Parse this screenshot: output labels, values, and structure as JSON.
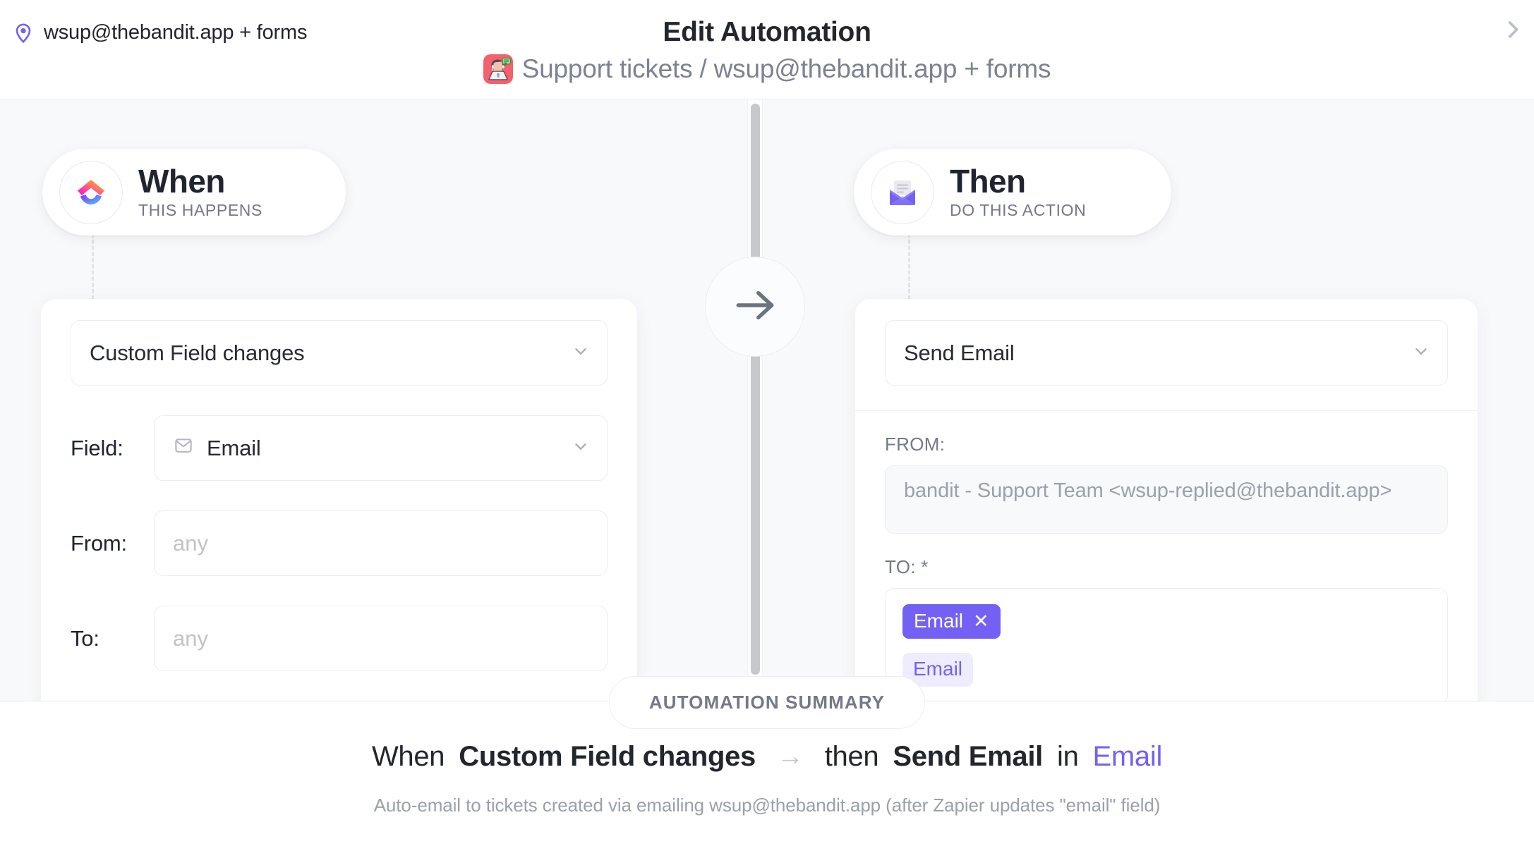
{
  "header": {
    "breadcrumb_label": "wsup@thebandit.app + forms",
    "pin_icon": "location-pin-icon",
    "title": "Edit Automation",
    "subtitle": "Support tickets / wsup@thebandit.app + forms",
    "subtitle_emoji": "support-agent-emoji",
    "close_icon": "chevron-right-icon"
  },
  "when": {
    "icon": "clickup-logo-icon",
    "title": "When",
    "subtitle": "THIS HAPPENS",
    "trigger": {
      "value": "Custom Field changes",
      "chevron": "chevron-down-icon"
    },
    "fields": [
      {
        "label": "Field:",
        "type": "select",
        "icon": "envelope-outline-icon",
        "value": "Email",
        "chevron": "chevron-down-icon"
      },
      {
        "label": "From:",
        "type": "input",
        "value": "",
        "placeholder": "any"
      },
      {
        "label": "To:",
        "type": "input",
        "value": "",
        "placeholder": "any"
      }
    ]
  },
  "connector": {
    "arrow_icon": "arrow-right-icon"
  },
  "then": {
    "icon": "open-envelope-icon",
    "title": "Then",
    "subtitle": "DO THIS ACTION",
    "action": {
      "value": "Send Email",
      "chevron": "chevron-down-icon"
    },
    "from": {
      "label": "FROM:",
      "value": "bandit - Support Team <wsup-replied@thebandit.app>"
    },
    "to": {
      "label": "TO: *",
      "tags": [
        {
          "label": "Email",
          "remove_icon": "close-x-icon"
        }
      ],
      "suggestion": "Email"
    }
  },
  "summary": {
    "chip_label": "AUTOMATION SUMMARY",
    "when_word": "When",
    "trigger_name": "Custom Field changes",
    "arrow": "→",
    "then_word": "then",
    "action_name": "Send Email",
    "in_word": "in",
    "target_name": "Email",
    "description": "Auto-email to tickets created via emailing wsup@thebandit.app (after Zapier updates \"email\" field)"
  },
  "colors": {
    "accent": "#7261f4",
    "canvas_bg": "#f8f9fb",
    "text": "#22262e",
    "muted": "#73798a"
  }
}
